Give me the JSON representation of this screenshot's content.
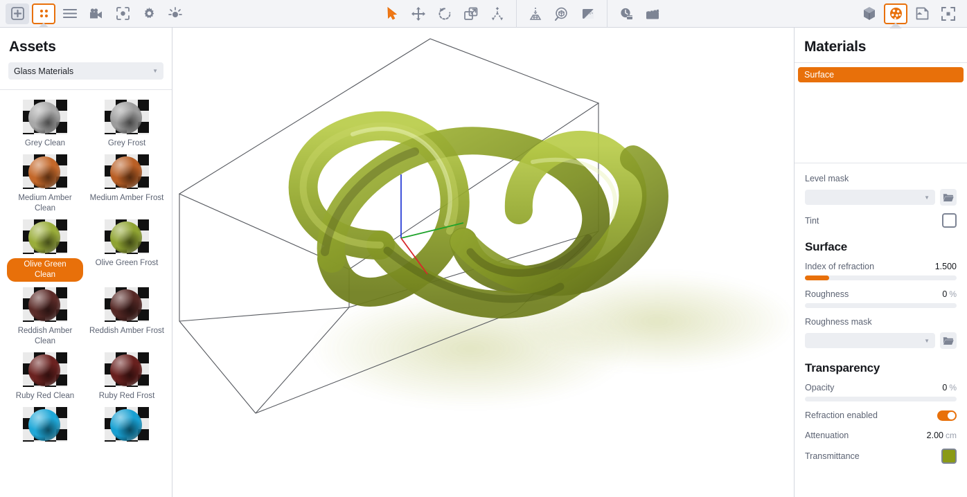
{
  "toolbar": {
    "left_group": [
      {
        "name": "add-icon",
        "label": "Add",
        "state": "boxed"
      },
      {
        "name": "scene-items-icon",
        "label": "Scene Items",
        "state": "active-orange"
      },
      {
        "name": "list-icon",
        "label": "List",
        "state": "normal"
      },
      {
        "name": "camera-icon",
        "label": "Camera",
        "state": "normal"
      },
      {
        "name": "focus-icon",
        "label": "Focus",
        "state": "normal"
      },
      {
        "name": "gear-icon",
        "label": "Settings",
        "state": "normal"
      },
      {
        "name": "light-icon",
        "label": "Light",
        "state": "normal"
      }
    ],
    "transform_group": [
      {
        "name": "select-arrow-icon",
        "label": "Select",
        "state": "active"
      },
      {
        "name": "move-icon",
        "label": "Move",
        "state": "normal"
      },
      {
        "name": "rotate-icon",
        "label": "Rotate",
        "state": "normal"
      },
      {
        "name": "scale-icon",
        "label": "Scale",
        "state": "normal"
      },
      {
        "name": "transform-icon",
        "label": "Transform",
        "state": "normal"
      }
    ],
    "tools_group": [
      {
        "name": "snap-to-ground-icon",
        "label": "Snap to Ground",
        "state": "normal"
      },
      {
        "name": "zoom-to-object-icon",
        "label": "Zoom to Object",
        "state": "normal"
      },
      {
        "name": "shading-icon",
        "label": "Shading",
        "state": "normal"
      }
    ],
    "time_group": [
      {
        "name": "timeline-icon",
        "label": "Timeline",
        "state": "normal"
      },
      {
        "name": "animation-icon",
        "label": "Animation",
        "state": "normal"
      }
    ],
    "right_group": [
      {
        "name": "geometry-icon",
        "label": "Geometry",
        "state": "normal"
      },
      {
        "name": "materials-icon",
        "label": "Materials",
        "state": "active-orange"
      },
      {
        "name": "environment-icon",
        "label": "Environment",
        "state": "normal"
      },
      {
        "name": "fullscreen-icon",
        "label": "Fullscreen",
        "state": "normal"
      }
    ]
  },
  "assets": {
    "title": "Assets",
    "category_selected": "Glass Materials",
    "selected_item": "Olive Green Clean",
    "items": [
      {
        "label": "Grey Clean",
        "color": "#a8a8a8",
        "selected": false
      },
      {
        "label": "Grey Frost",
        "color": "#9c9c9c",
        "selected": false
      },
      {
        "label": "Medium Amber Clean",
        "color": "#c4682a",
        "selected": false
      },
      {
        "label": "Medium Amber Frost",
        "color": "#b95f25",
        "selected": false
      },
      {
        "label": "Olive Green Clean",
        "color": "#9aad3a",
        "selected": true
      },
      {
        "label": "Olive Green Frost",
        "color": "#8fa332",
        "selected": false
      },
      {
        "label": "Reddish Amber Clean",
        "color": "#5b2b28",
        "selected": false
      },
      {
        "label": "Reddish Amber Frost",
        "color": "#552825",
        "selected": false
      },
      {
        "label": "Ruby Red Clean",
        "color": "#6b2220",
        "selected": false
      },
      {
        "label": "Ruby Red Frost",
        "color": "#68201e",
        "selected": false
      },
      {
        "label": "",
        "color": "#1fa8d8",
        "selected": false
      },
      {
        "label": "",
        "color": "#18a0d2",
        "selected": false
      }
    ]
  },
  "materials": {
    "title": "Materials",
    "list": [
      {
        "label": "Surface",
        "selected": true
      }
    ],
    "level_mask": {
      "label": "Level mask",
      "value": "",
      "browse_icon": "folder-icon"
    },
    "tint": {
      "label": "Tint",
      "checked": false
    },
    "surface": {
      "heading": "Surface",
      "index_of_refraction": {
        "label": "Index of refraction",
        "value": "1.500",
        "fill_percent": 16
      },
      "roughness": {
        "label": "Roughness",
        "value": "0",
        "unit": "%",
        "fill_percent": 0
      },
      "roughness_mask": {
        "label": "Roughness mask",
        "value": "",
        "browse_icon": "folder-icon"
      }
    },
    "transparency": {
      "heading": "Transparency",
      "opacity": {
        "label": "Opacity",
        "value": "0",
        "unit": "%",
        "fill_percent": 0
      },
      "refraction_enabled": {
        "label": "Refraction enabled",
        "on": true
      },
      "attenuation": {
        "label": "Attenuation",
        "value": "2.00",
        "unit": "cm"
      },
      "transmittance": {
        "label": "Transmittance",
        "color": "#8a9a16"
      }
    }
  },
  "viewport": {
    "object": "glass-knot",
    "material_color": "#9aad3a",
    "axis_colors": {
      "x": "#d6282b",
      "y": "#1fa32b",
      "z": "#2b3fd6"
    },
    "bounding_box_visible": true,
    "background": "#ffffff"
  },
  "theme": {
    "accent": "#e8700a",
    "toolbar_bg": "#f3f4f7",
    "panel_bg": "#ffffff",
    "text": "#16181d",
    "muted_text": "#5c6373"
  }
}
